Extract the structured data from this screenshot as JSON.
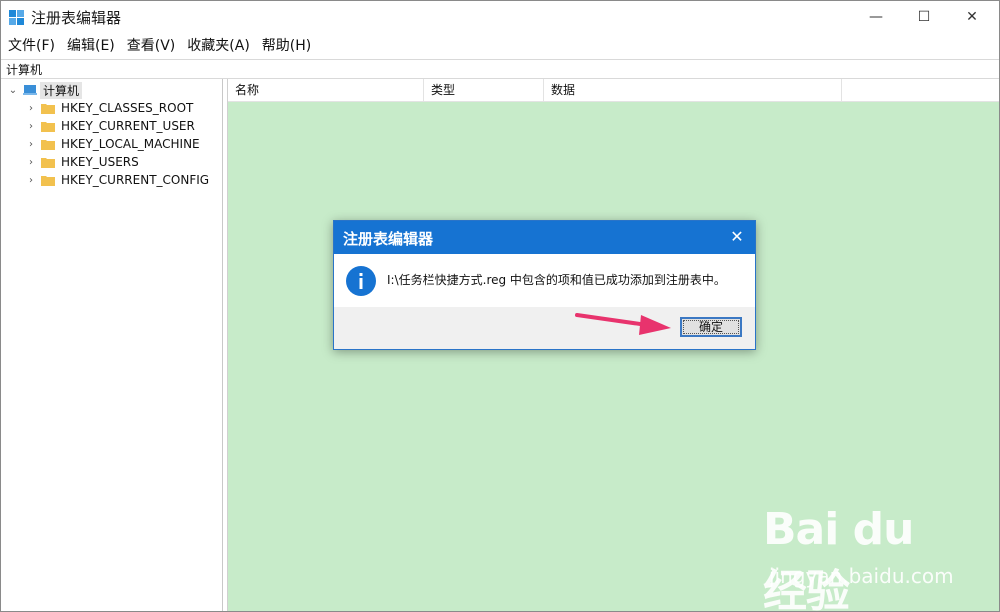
{
  "window": {
    "title": "注册表编辑器",
    "controls": {
      "minimize": "—",
      "maximize": "☐",
      "close": "✕"
    }
  },
  "menu": [
    "文件(F)",
    "编辑(E)",
    "查看(V)",
    "收藏夹(A)",
    "帮助(H)"
  ],
  "address": "计算机",
  "tree": {
    "root": "计算机",
    "children": [
      "HKEY_CLASSES_ROOT",
      "HKEY_CURRENT_USER",
      "HKEY_LOCAL_MACHINE",
      "HKEY_USERS",
      "HKEY_CURRENT_CONFIG"
    ]
  },
  "columns": [
    "名称",
    "类型",
    "数据"
  ],
  "dialog": {
    "title": "注册表编辑器",
    "message": "I:\\任务栏快捷方式.reg 中包含的项和值已成功添加到注册表中。",
    "ok_label": "确定",
    "close": "✕",
    "icon": "info-icon"
  },
  "watermark": {
    "logo": "Bai du 经验",
    "url": "jingyan.baidu.com"
  },
  "colors": {
    "content_bg": "#c7ebc9",
    "dialog_title": "#1673d2",
    "arrow": "#e8336d"
  }
}
